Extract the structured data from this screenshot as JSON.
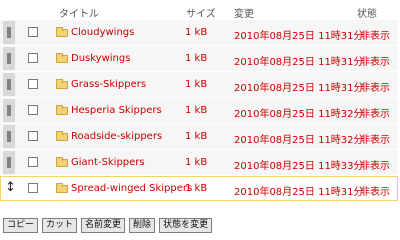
{
  "header": {
    "title": "タイトル",
    "size": "サイズ",
    "modified": "変更",
    "status": "状態"
  },
  "rows": [
    {
      "name": "Cloudywings",
      "size": "1 kB",
      "date": "2010年08月25日 11時31分",
      "status": "非表示",
      "checked": false
    },
    {
      "name": "Duskywings",
      "size": "1 kB",
      "date": "2010年08月25日 11時31分",
      "status": "非表示",
      "checked": false
    },
    {
      "name": "Grass-Skippers",
      "size": "1 kB",
      "date": "2010年08月25日 11時31分",
      "status": "非表示",
      "checked": false
    },
    {
      "name": "Hesperia Skippers",
      "size": "1 kB",
      "date": "2010年08月25日 11時32分",
      "status": "非表示",
      "checked": false
    },
    {
      "name": "Roadside-skippers",
      "size": "1 kB",
      "date": "2010年08月25日 11時32分",
      "status": "非表示",
      "checked": false
    },
    {
      "name": "Giant-Skippers",
      "size": "1 kB",
      "date": "2010年08月25日 11時33分",
      "status": "非表示",
      "checked": false
    },
    {
      "name": "Spread-winged Skippers",
      "size": "1 kB",
      "date": "2010年08月25日 11時31分",
      "status": "非表示",
      "checked": false,
      "selected": true
    }
  ],
  "toolbar": {
    "copy": "コピー",
    "cut": "カット",
    "rename": "名前変更",
    "delete": "削除",
    "change_status": "状態を変更"
  },
  "icons": {
    "folder": "folder-icon",
    "grip": "drag-handle-icon",
    "resize": "resize-vertical-icon"
  },
  "colors": {
    "link": "#cc0000",
    "row_bg": "#f6f6f6",
    "selected_border": "#f3d36a"
  }
}
